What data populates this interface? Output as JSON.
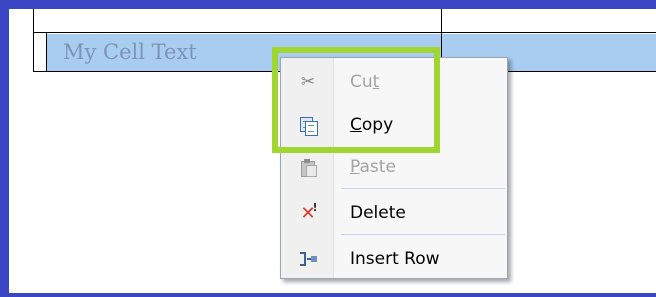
{
  "table": {
    "selected_cell_text": "My Cell Text"
  },
  "context_menu": {
    "items": [
      {
        "label_pre": "Cu",
        "underline": "t",
        "label_post": "",
        "enabled": false,
        "icon": "scissors-icon"
      },
      {
        "label_pre": "",
        "underline": "C",
        "label_post": "opy",
        "enabled": true,
        "icon": "copy-icon"
      },
      {
        "label_pre": "",
        "underline": "P",
        "label_post": "aste",
        "enabled": false,
        "icon": "paste-icon"
      },
      {
        "label_pre": "Delete",
        "underline": "",
        "label_post": "",
        "enabled": true,
        "icon": "delete-icon"
      },
      {
        "label_pre": "Insert Row",
        "underline": "",
        "label_post": "",
        "enabled": true,
        "icon": "insert-row-icon"
      }
    ]
  },
  "colors": {
    "frame": "#3b46c6",
    "selection": "#a9cdf1",
    "highlight": "#a1d530"
  }
}
